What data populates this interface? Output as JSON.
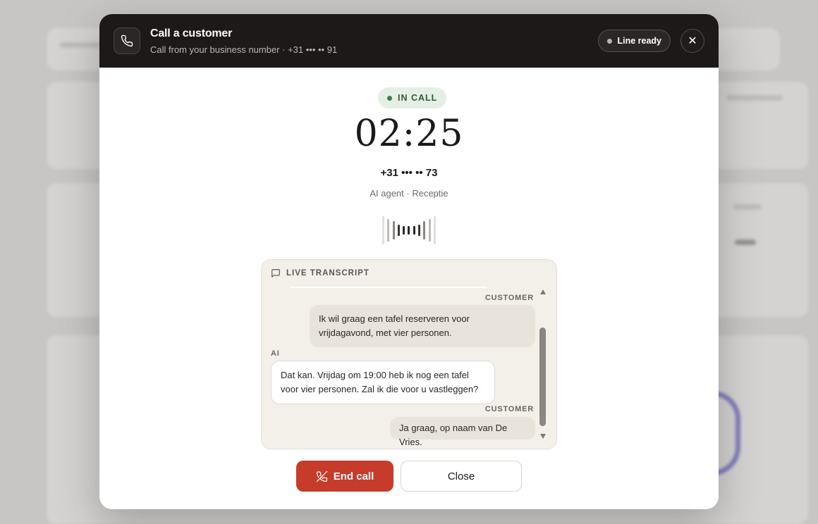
{
  "modal": {
    "title": "Call a customer",
    "subtitle": "Call from your business number · +31 ••• •• 91",
    "line_status": "Line ready",
    "close_icon": "close-icon",
    "phone_icon": "phone-icon"
  },
  "call": {
    "status": "IN CALL",
    "timer": "02:25",
    "number": "+31 ••• •• 73",
    "agent": "AI agent · Receptie",
    "status_color": "#3d7d48"
  },
  "transcript": {
    "heading": "LIVE TRANSCRIPT",
    "messages": [
      {
        "role": "CUSTOMER",
        "text": "Ik wil graag een tafel reserveren voor vrijdagavond, met vier personen."
      },
      {
        "role": "AI",
        "text": "Dat kan. Vrijdag om 19:00 heb ik nog een tafel voor vier personen. Zal ik die voor u vastleggen?"
      },
      {
        "role": "CUSTOMER",
        "text": "Ja graag, op naam van De Vries."
      }
    ]
  },
  "actions": {
    "end_call": "End call",
    "close": "Close"
  },
  "colors": {
    "header_bg": "#1c1918",
    "end_call": "#c63b2a",
    "transcript_bg": "#f3f0ea"
  }
}
